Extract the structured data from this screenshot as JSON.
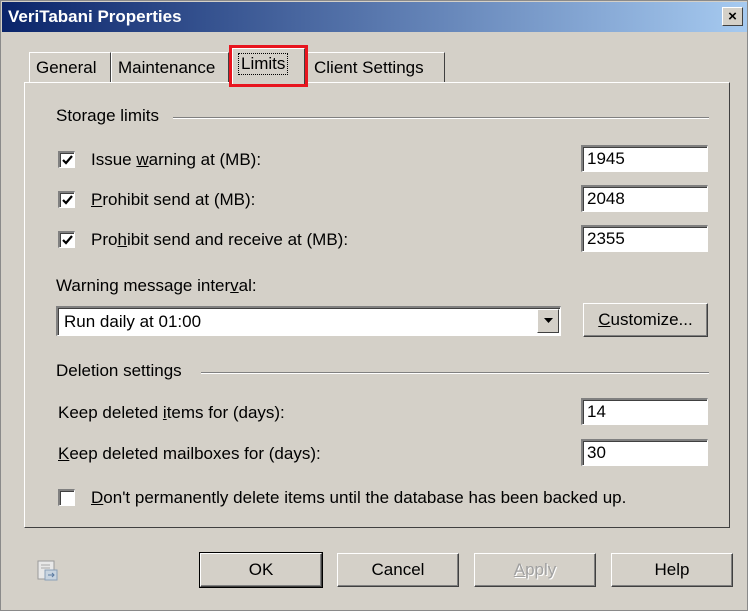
{
  "window": {
    "title": "VeriTabani Properties",
    "close_label": "×"
  },
  "tabs": [
    {
      "label": "General"
    },
    {
      "label": "Maintenance"
    },
    {
      "label": "Limits"
    },
    {
      "label": "Client Settings"
    }
  ],
  "active_tab": "Limits",
  "storage": {
    "heading": "Storage limits",
    "issue_warning": {
      "label_pre": "Issue ",
      "label_u": "w",
      "label_post": "arning at (MB):",
      "checked": true,
      "value": "1945"
    },
    "prohibit_send": {
      "label_pre": "",
      "label_u": "P",
      "label_post": "rohibit send at (MB):",
      "checked": true,
      "value": "2048"
    },
    "prohibit_send_receive": {
      "label_pre": "Pro",
      "label_u": "h",
      "label_post": "ibit send and receive at (MB):",
      "checked": true,
      "value": "2355"
    }
  },
  "warning_interval": {
    "label_pre": "Warning message inter",
    "label_u": "v",
    "label_post": "al:",
    "selected": "Run daily at 01:00",
    "customize_u": "C",
    "customize_post": "ustomize..."
  },
  "deletion": {
    "heading": "Deletion settings",
    "keep_items": {
      "label_pre": "Keep deleted ",
      "label_u": "i",
      "label_post": "tems for (days):",
      "value": "14"
    },
    "keep_mailboxes": {
      "label_pre": "",
      "label_u": "K",
      "label_post": "eep deleted mailboxes for (days):",
      "value": "30"
    },
    "dont_delete": {
      "label_pre": "",
      "label_u": "D",
      "label_post": "on't permanently delete items until the database has been backed up.",
      "checked": false
    }
  },
  "buttons": {
    "ok": "OK",
    "cancel": "Cancel",
    "apply_u": "A",
    "apply_post": "pply",
    "help": "Help"
  },
  "icons": {
    "help": "help-icon",
    "close": "close-icon",
    "check": "check-icon",
    "dropdown": "chevron-down-icon"
  }
}
